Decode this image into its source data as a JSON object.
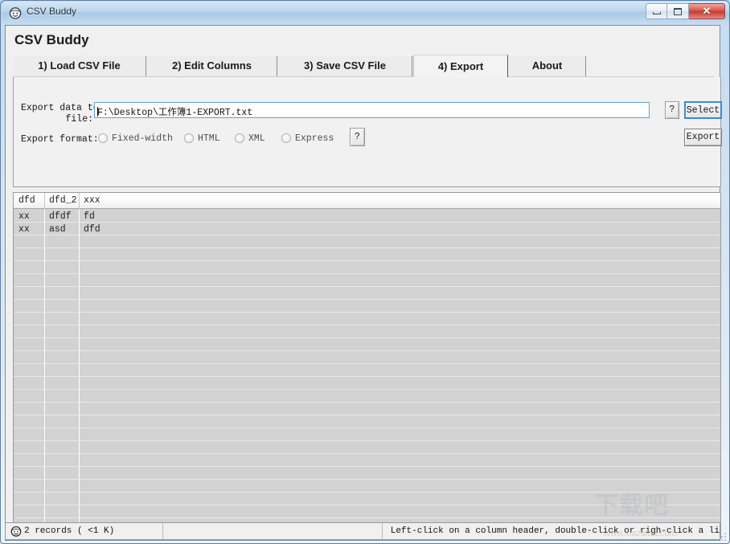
{
  "window": {
    "title": "CSV Buddy",
    "icon": "smiley-face-icon",
    "minimize_label": "",
    "maximize_label": "",
    "close_label": "✕"
  },
  "app": {
    "heading": "CSV Buddy"
  },
  "tabs": [
    {
      "label": "1) Load CSV File",
      "active": false
    },
    {
      "label": "2) Edit Columns",
      "active": false
    },
    {
      "label": "3) Save CSV File",
      "active": false
    },
    {
      "label": "4) Export",
      "active": true
    },
    {
      "label": "About",
      "active": false
    }
  ],
  "export_panel": {
    "file_label_line1": "Export data to",
    "file_label_line2": "file:",
    "file_path_value": "F:\\Desktop\\工作簿1-EXPORT.txt",
    "file_path_placeholder": "",
    "help_button_1_label": "?",
    "select_button_label": "Select",
    "format_label": "Export format:",
    "format_options": [
      {
        "label": "Fixed-width",
        "selected": false
      },
      {
        "label": "HTML",
        "selected": false
      },
      {
        "label": "XML",
        "selected": false
      },
      {
        "label": "Express",
        "selected": false
      }
    ],
    "help_button_2_label": "?",
    "export_button_label": "Export"
  },
  "grid": {
    "columns": [
      "dfd",
      "dfd_2",
      "xxx"
    ],
    "rows": [
      [
        "xx",
        "dfdf",
        "fd"
      ],
      [
        "xx",
        "asd",
        "dfd"
      ]
    ],
    "empty_row_count": 24
  },
  "statusbar": {
    "icon": "smiley-face-icon",
    "records_text": "2 records ( <1 K)",
    "middle_text": "",
    "hint_text": "Left-click on a column header, double-click or righ-click a li"
  },
  "watermark": {
    "text": "下载吧",
    "subtext": "www.xiazaiba.com"
  },
  "colors": {
    "titlebar_accent": "#a9c9e6",
    "close_button": "#c23c33",
    "focus_border": "#3c8ad0",
    "grid_background": "#d2d2d2",
    "panel_background": "#f1f1f1"
  }
}
